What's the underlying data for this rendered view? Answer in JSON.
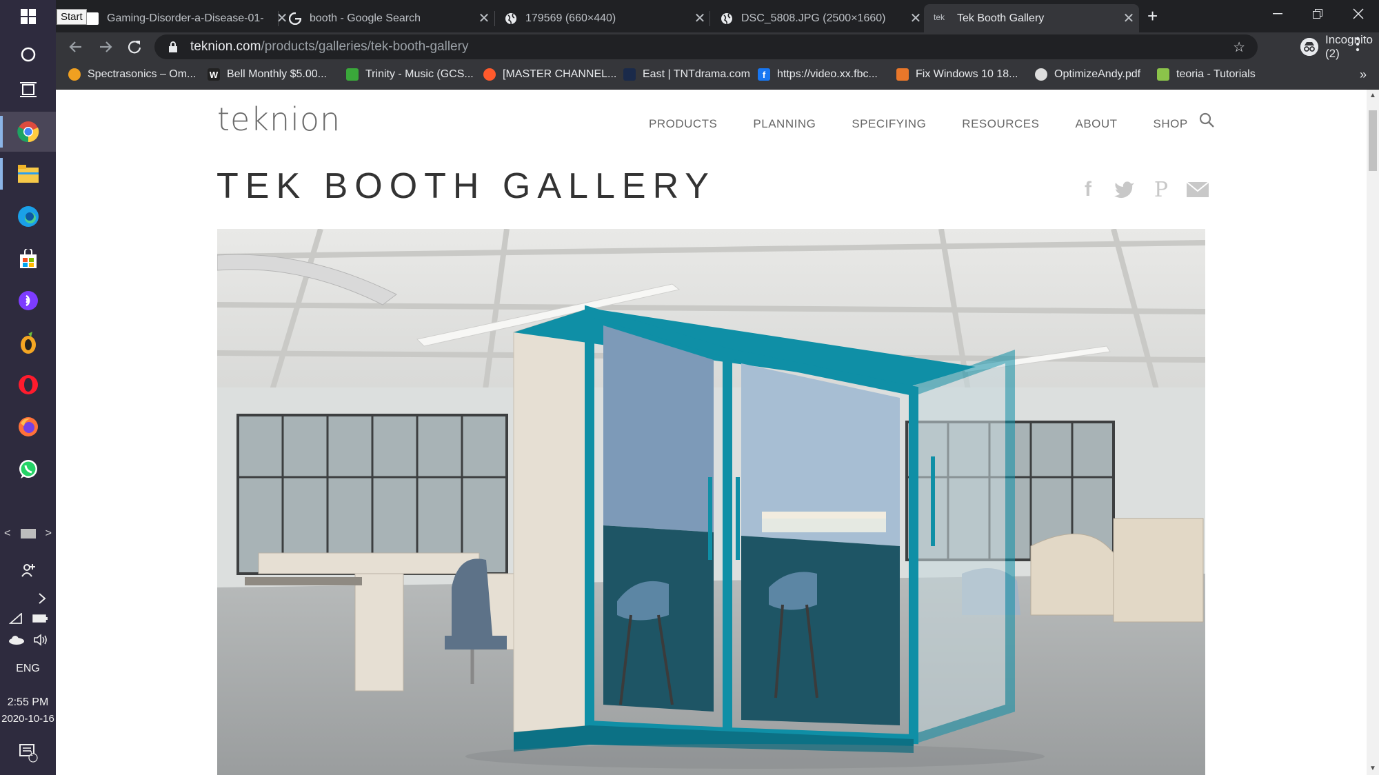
{
  "taskbar": {
    "start_tooltip": "Start",
    "apps": [
      {
        "icon": "windows-start-icon"
      },
      {
        "icon": "cortana-search-icon"
      },
      {
        "icon": "task-view-icon"
      },
      {
        "icon": "chrome-icon",
        "color": "#dd4b3e"
      },
      {
        "icon": "file-explorer-icon",
        "color": "#f7c948"
      },
      {
        "icon": "edge-icon",
        "color": "#1aa0e8"
      },
      {
        "icon": "store-icon",
        "color": "#2e7be0"
      },
      {
        "icon": "podcast-app-icon",
        "color": "#7d3cff"
      },
      {
        "icon": "fl-studio-icon",
        "color": "#f4a623"
      },
      {
        "icon": "opera-icon",
        "color": "#ff1b2d"
      },
      {
        "icon": "firefox-icon",
        "color": "#ff7139"
      },
      {
        "icon": "whatsapp-icon",
        "color": "#25d366"
      }
    ],
    "language": "ENG",
    "time": "2:55 PM",
    "date": "2020-10-16",
    "notification_count": "1"
  },
  "browser": {
    "tabs": [
      {
        "title": "Gaming-Disorder-a-Disease-01-",
        "favicon_color": "#ffffff",
        "active": false
      },
      {
        "title": "booth - Google Search",
        "favicon": "google-icon",
        "active": false
      },
      {
        "title": "179569 (660×440)",
        "favicon": "globe-icon",
        "active": false
      },
      {
        "title": "DSC_5808.JPG (2500×1660)",
        "favicon": "globe-icon",
        "active": false
      },
      {
        "title": "Tek Booth Gallery",
        "favicon_text": "tek",
        "active": true
      }
    ],
    "new_tab_label": "+",
    "url_domain": "teknion.com",
    "url_path": "/products/galleries/tek-booth-gallery",
    "incognito_label": "Incognito (2)",
    "bookmarks": [
      {
        "label": "Spectrasonics – Om...",
        "color": "#f0a020"
      },
      {
        "label": "Bell Monthly $5.00...",
        "color": "#222222",
        "glyph": "W"
      },
      {
        "label": "Trinity - Music (GCS...",
        "color": "#3aa83a"
      },
      {
        "label": "[MASTER CHANNEL...",
        "color": "#ff5a2c"
      },
      {
        "label": "East | TNTdrama.com",
        "color": "#1a2a4a"
      },
      {
        "label": "https://video.xx.fbc...",
        "color": "#1877f2",
        "glyph": "f"
      },
      {
        "label": "Fix Windows 10 18...",
        "color": "#e9772a"
      },
      {
        "label": "OptimizeAndy.pdf",
        "color": "#dddddd"
      },
      {
        "label": "teoria - Tutorials",
        "color": "#8bc34a"
      }
    ],
    "bookmarks_more": "»"
  },
  "site": {
    "logo": "teknion",
    "nav": [
      "PRODUCTS",
      "PLANNING",
      "SPECIFYING",
      "RESOURCES",
      "ABOUT",
      "SHOP"
    ],
    "page_title": "TEK BOOTH GALLERY",
    "share": [
      "facebook-icon",
      "twitter-icon",
      "pinterest-icon",
      "email-icon"
    ],
    "share_glyphs": {
      "facebook": "f",
      "pinterest": "P"
    }
  },
  "colors": {
    "booth_teal": "#0f8fa6",
    "booth_panel": "#e6dfd3",
    "booth_inner": "#1e5565"
  }
}
